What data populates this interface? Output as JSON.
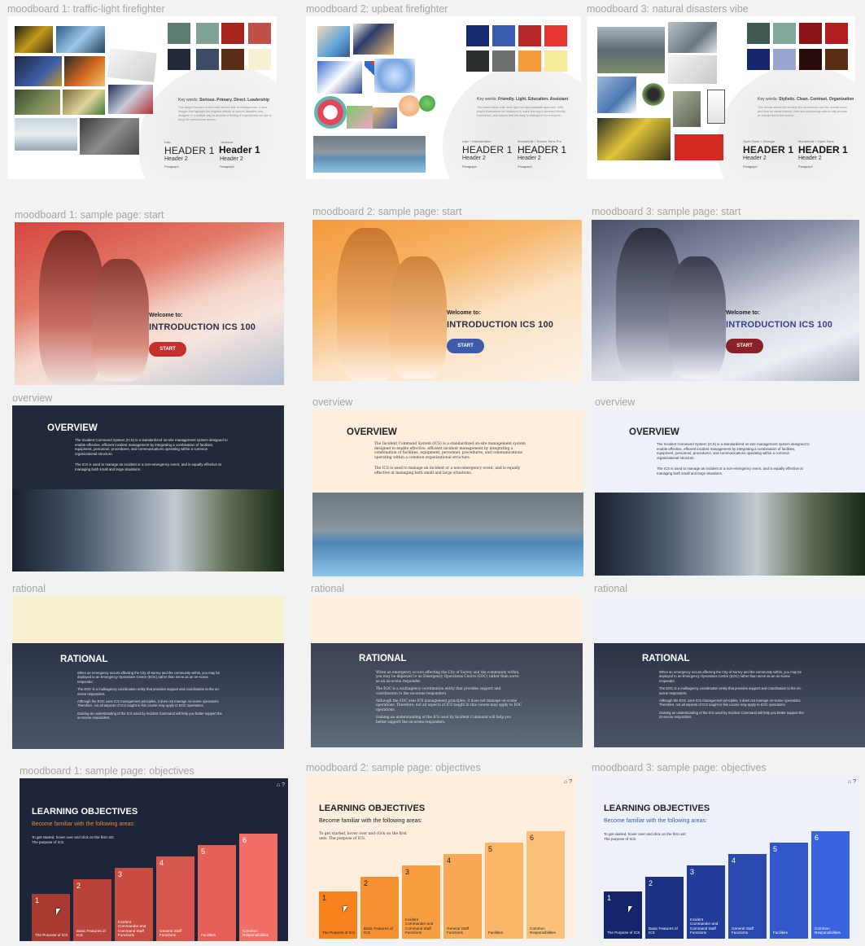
{
  "labels": {
    "mb1": "moodboard 1: traffic-light firefighter",
    "mb2": "moodboard 2: upbeat firefighter",
    "mb3": "moodboard 3: natural disasters vibe",
    "sp1": "moodboard 1: sample page: start",
    "sp2": "moodboard 2: sample page: start",
    "sp3": "moodboard 3: sample page: start",
    "ov1": "overview",
    "ov2": "overview",
    "ov3": "overview",
    "ra1": "rational",
    "ra2": "rational",
    "ra3": "rational",
    "ob1": "moodboard 1: sample page: objectives",
    "ob2": "moodboard 2: sample page: objectives",
    "ob3": "moodboard 3: sample page: objectives"
  },
  "moodboards": [
    {
      "swatches": [
        "#5b7d74",
        "#7fa297",
        "#a8241f",
        "#c0504a",
        "#222a3a",
        "#3d4b66",
        "#5a2d16",
        "#f6f1d3"
      ],
      "keywords_label": "Key words:",
      "keywords": "Serious. Primary. Direct. Leadership",
      "paragraph": "This playful focuses on the more severe side of emergencies. It uses images that highlight the negative effects of various disasters and disagree in a realistic way to provoke a feeling of urgency that we use to bring the seriousness across.",
      "font1": "Lato",
      "font2": "Verdana",
      "h1a": "HEADER 1",
      "h1b": "Header 1",
      "h2a": "Header 2",
      "h2b": "Header 2",
      "p1": "Paragraph",
      "p2": "Paragraph"
    },
    {
      "swatches": [
        "#162a6e",
        "#3a5bb0",
        "#b8282a",
        "#e63631",
        "#2b2f2e",
        "#6d716f",
        "#f59a3b",
        "#f7ea9a"
      ],
      "keywords_label": "Key words:",
      "keywords": "Friendly. Light. Education. Assistant",
      "paragraph": "This board takes a far more light and approachable approach. With playful illustrations we endeavor to make learning a pleasant friendly experience, and colours that are easy to distinguish for everyone.",
      "font1": "Lato + Merriweather",
      "font2": "Montserrat + Source Sans Pro",
      "h1a": "HEADER 1",
      "h1b": "HEADER 1",
      "h2a": "Header 2",
      "h2b": "Header 2",
      "p1": "Paragraph",
      "p2": "Paragraph"
    },
    {
      "swatches": [
        "#3f5a50",
        "#7fa898",
        "#8d1515",
        "#b01e22",
        "#14256b",
        "#9aa6cf",
        "#2a0b0b",
        "#5a2f14"
      ],
      "keywords_label": "Key words:",
      "keywords": "Stylistic. Clean. Contrast. Organization",
      "paragraph": "This results shows the emotion the productions and the overall mood and tone for visual interest. Bold and contrasting colours help provide an overall feel of the course.",
      "font1": "Open Sans + Georgia",
      "font2": "Montserrat + Open Sans",
      "h1a": "HEADER 1",
      "h1b": "HEADER 1",
      "h2a": "Header 2",
      "h2b": "Header 2",
      "p1": "Paragraph",
      "p2": "Paragraph"
    }
  ],
  "start": {
    "welcome": "Welcome to:",
    "title": "INTRODUCTION ICS 100",
    "button": "START",
    "colors": [
      "#c4302b",
      "#3f5aa8",
      "#8b2124"
    ],
    "title_colors": [
      "#2a2f45",
      "#2a2f45",
      "#3c3e8c"
    ]
  },
  "overview": {
    "title": "OVERVIEW",
    "p1": "The Incident Command System (ICS) is a standardized on-site management system designed to enable effective, efficient incident management by integrating a combination of facilities, equipment, personnel, procedures, and communications operating within a common organizational structure.",
    "p2": "The ICS is used to manage an incident or a non-emergency event, and is equally effective at managing both small and large situations."
  },
  "rational": {
    "title": "RATIONAL",
    "p1": "When an emergency occurs affecting the City of Surrey and the community within, you may be deployed to an Emergency Operations Centre (EOC) rather than serve as an on-scene responder.",
    "p2": "The EOC is a multiagency coordination entity that provides support and coordination to the on-scene responders.",
    "p3": "Although the EOC uses ICS management principles, it does not manage on-scene operations. Therefore, not all aspects of ICS taught in this course may apply to EOC operations.",
    "p4": "Gaining an understanding of the ICS used by Incident Command will help you better support the on-scene responders."
  },
  "objectives": {
    "title": "LEARNING OBJECTIVES",
    "subtitle": "Become familiar with the following areas:",
    "text": "To get started, hover over and click on the first unit: The purpose of ICS.",
    "icons": "⌂ ?",
    "bars": [
      {
        "num": "1",
        "label": "The Purpose of ICS"
      },
      {
        "num": "2",
        "label": "Basic Features of ICS"
      },
      {
        "num": "3",
        "label": "Incident Commander and Command Staff Functions"
      },
      {
        "num": "4",
        "label": "General Staff Functions"
      },
      {
        "num": "5",
        "label": "Facilities"
      },
      {
        "num": "6",
        "label": "Common Responsibilities"
      }
    ],
    "palettes": [
      {
        "bg": "#1f2538",
        "title": "#ffffff",
        "sub": "#e08a3c",
        "text": "#e6e6e6",
        "bars": [
          "#a83a30",
          "#b9433a",
          "#c94c43",
          "#d7574d",
          "#e56158",
          "#f26f66"
        ],
        "barText": "#ffffff"
      },
      {
        "bg": "#fdeedd",
        "title": "#222222",
        "sub": "#222222",
        "text": "#333333",
        "bars": [
          "#f6821e",
          "#f79030",
          "#f89d41",
          "#f9a954",
          "#fab566",
          "#fbc17a"
        ],
        "barText": "#222222"
      },
      {
        "bg": "#eef1fa",
        "title": "#222222",
        "sub": "#3a5bb0",
        "text": "#333333",
        "bars": [
          "#14256b",
          "#1b3182",
          "#223d99",
          "#2a4ab0",
          "#3257c8",
          "#3a64df"
        ],
        "barText": "#ffffff"
      }
    ]
  }
}
